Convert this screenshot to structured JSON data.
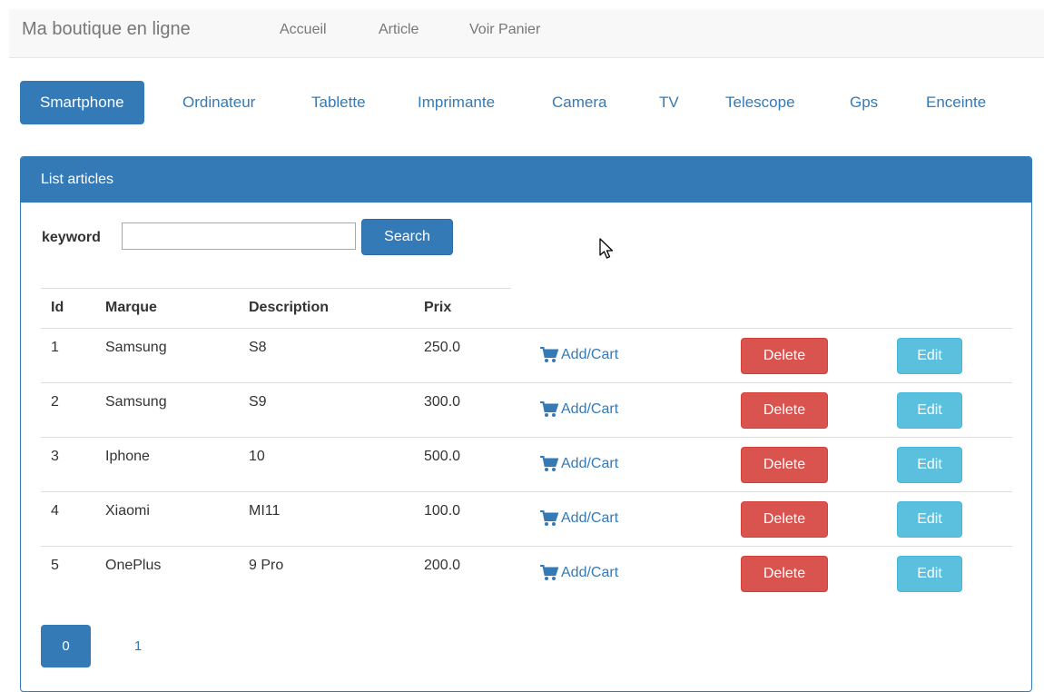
{
  "navbar": {
    "brand": "Ma boutique en ligne",
    "links": [
      "Accueil",
      "Article",
      "Voir Panier"
    ]
  },
  "categories": {
    "active": "Smartphone",
    "items": [
      "Smartphone",
      "Ordinateur",
      "Tablette",
      "Imprimante",
      "Camera",
      "TV",
      "Telescope",
      "Gps",
      "Enceinte"
    ]
  },
  "panel": {
    "title": "List articles",
    "search": {
      "label": "keyword",
      "value": "",
      "placeholder": "",
      "button": "Search"
    }
  },
  "table": {
    "headers": [
      "Id",
      "Marque",
      "Description",
      "Prix"
    ],
    "rows": [
      {
        "id": "1",
        "marque": "Samsung",
        "description": "S8",
        "prix": "250.0"
      },
      {
        "id": "2",
        "marque": "Samsung",
        "description": "S9",
        "prix": "300.0"
      },
      {
        "id": "3",
        "marque": "Iphone",
        "description": "10",
        "prix": "500.0"
      },
      {
        "id": "4",
        "marque": "Xiaomi",
        "description": "MI11",
        "prix": "100.0"
      },
      {
        "id": "5",
        "marque": "OnePlus",
        "description": "9 Pro",
        "prix": "200.0"
      }
    ],
    "actions": {
      "add_cart": "Add/Cart",
      "delete": "Delete",
      "edit": "Edit"
    }
  },
  "pagination": {
    "pages": [
      "0",
      "1"
    ],
    "current": "0"
  },
  "icons": {
    "cart": "shopping-cart-icon",
    "cursor": "mouse-pointer-icon"
  },
  "colors": {
    "primary": "#337ab7",
    "danger": "#d9534f",
    "info": "#5bc0de"
  }
}
